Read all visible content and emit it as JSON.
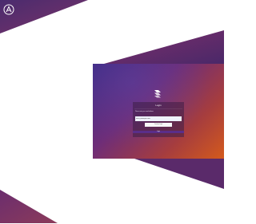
{
  "brand": {
    "corner_logo_icon": "a-arrow-logo-icon",
    "app_logo_icon": "stacked-chevron-logo-icon",
    "colors": {
      "purple_dark": "#3e2a83",
      "magenta": "#6e2d78",
      "orange": "#d45a1c",
      "band": "#5a2e8a"
    }
  },
  "login": {
    "title": "Login",
    "hint": "Please enter your email address",
    "email_value": "user@example.com",
    "submit_label": "Continue login",
    "footer_text": "Login"
  }
}
